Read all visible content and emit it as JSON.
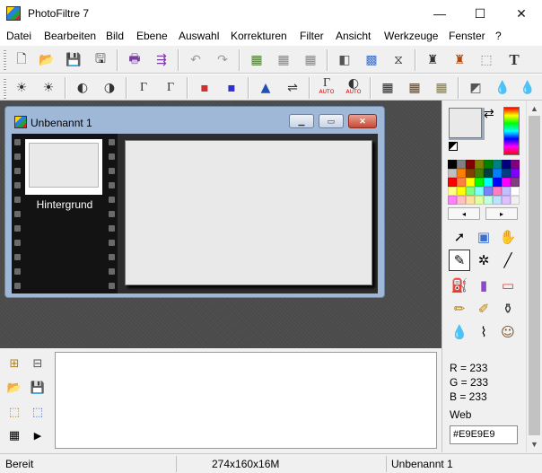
{
  "window": {
    "title": "PhotoFiltre 7",
    "minimize": "—",
    "maximize": "☐",
    "close": "✕"
  },
  "menu": [
    {
      "label": "Datei"
    },
    {
      "label": "Bearbeiten"
    },
    {
      "label": "Bild"
    },
    {
      "label": "Ebene"
    },
    {
      "label": "Auswahl"
    },
    {
      "label": "Korrekturen"
    },
    {
      "label": "Filter"
    },
    {
      "label": "Ansicht"
    },
    {
      "label": "Werkzeuge"
    },
    {
      "label": "Fenster"
    },
    {
      "label": "?"
    }
  ],
  "toolbar1": {
    "icons": [
      "new-icon",
      "open-icon",
      "save-icon",
      "save-as-icon",
      "print-icon",
      "scan-icon",
      "undo-icon",
      "redo-icon",
      "image-icon",
      "image-gray-icon",
      "image-copy-icon",
      "gradient-icon",
      "color-grid-icon",
      "transform-icon",
      "person-icon",
      "person-frame-icon",
      "selection-icon",
      "text-icon"
    ],
    "glyphs": [
      "🗋",
      "📂",
      "💾",
      "🖫",
      "🖶",
      "⇶",
      "↶",
      "↷",
      "▦",
      "▦",
      "▦",
      "◧",
      "▩",
      "⧖",
      "♜",
      "♜",
      "⬚",
      "T"
    ]
  },
  "toolbar2": {
    "icons": [
      "brightness-minus-icon",
      "brightness-plus-icon",
      "contrast-minus-icon",
      "contrast-plus-icon",
      "gamma-minus-icon",
      "gamma-plus-icon",
      "saturation-minus-icon",
      "saturation-plus-icon",
      "levels-icon",
      "curves-icon",
      "auto-levels-icon",
      "auto-contrast-icon",
      "grid-dark-icon",
      "grid-brown-icon",
      "grid-olive-icon",
      "fade-icon",
      "drop-icon",
      "drop-fill-icon"
    ],
    "glyphs": [
      "☀",
      "☀",
      "◐",
      "◑",
      "Γ",
      "Γ",
      "▪",
      "▪",
      "▲",
      "⇌",
      "Γ",
      "◐",
      "▦",
      "▦",
      "▦",
      "◩",
      "💧",
      "💧"
    ],
    "auto_label": "AUTO"
  },
  "document": {
    "title": "Unbenannt 1",
    "layer_name": "Hintergrund",
    "canvas_color": "#E9E9E9"
  },
  "colors": {
    "foreground": "#E9E9E9",
    "background": "#9AABBD",
    "palette": [
      "#000000",
      "#808080",
      "#800000",
      "#808000",
      "#008000",
      "#008080",
      "#000080",
      "#800080",
      "#c0c0c0",
      "#ff8000",
      "#804000",
      "#408000",
      "#004040",
      "#0080ff",
      "#004080",
      "#8000ff",
      "#ff0000",
      "#ff8040",
      "#ffff00",
      "#00ff00",
      "#00ffff",
      "#0000ff",
      "#ff00ff",
      "#804080",
      "#ffff80",
      "#ffff00",
      "#80ff80",
      "#80ffff",
      "#8080ff",
      "#ff80c0",
      "#c0c0ff",
      "#ffffff",
      "#ff80ff",
      "#ffc0c0",
      "#ffe0a0",
      "#e0ffa0",
      "#c0ffe0",
      "#c0e0ff",
      "#e0c0ff",
      "#f0f0f0"
    ],
    "prev_label": "◂",
    "next_label": "▸"
  },
  "tools": {
    "names": [
      "arrow-tool-icon",
      "select-tool-icon",
      "hand-tool-icon",
      "eyedropper-tool-icon",
      "magic-wand-tool-icon",
      "line-tool-icon",
      "fill-bucket-tool-icon",
      "spray-tool-icon",
      "eraser-tool-icon",
      "brush-tool-icon",
      "advanced-brush-tool-icon",
      "stamp-tool-icon",
      "blur-drop-tool-icon",
      "smudge-tool-icon",
      "clone-portrait-tool-icon"
    ],
    "glyphs": [
      "➚",
      "▣",
      "✋",
      "✎",
      "✲",
      "╱",
      "⛽",
      "▮",
      "▭",
      "✏",
      "✐",
      "⚱",
      "💧",
      "⌇",
      "☺"
    ]
  },
  "color_info": {
    "r": "R = 233",
    "g": "G = 233",
    "b": "B = 233",
    "web_label": "Web",
    "web_value": "#E9E9E9"
  },
  "bottom_tools": {
    "names": [
      "layer-tree-icon",
      "layer-props-icon",
      "open-folder-icon",
      "save-doc-icon",
      "select-rect-icon",
      "select-rect-alt-icon",
      "grid-doc-icon",
      "play-icon"
    ],
    "glyphs": [
      "⊞",
      "⊟",
      "📂",
      "💾",
      "⬚",
      "⬚",
      "▦",
      "▶"
    ]
  },
  "status": {
    "state": "Bereit",
    "size": "274x160x16M",
    "document": "Unbenannt 1"
  }
}
